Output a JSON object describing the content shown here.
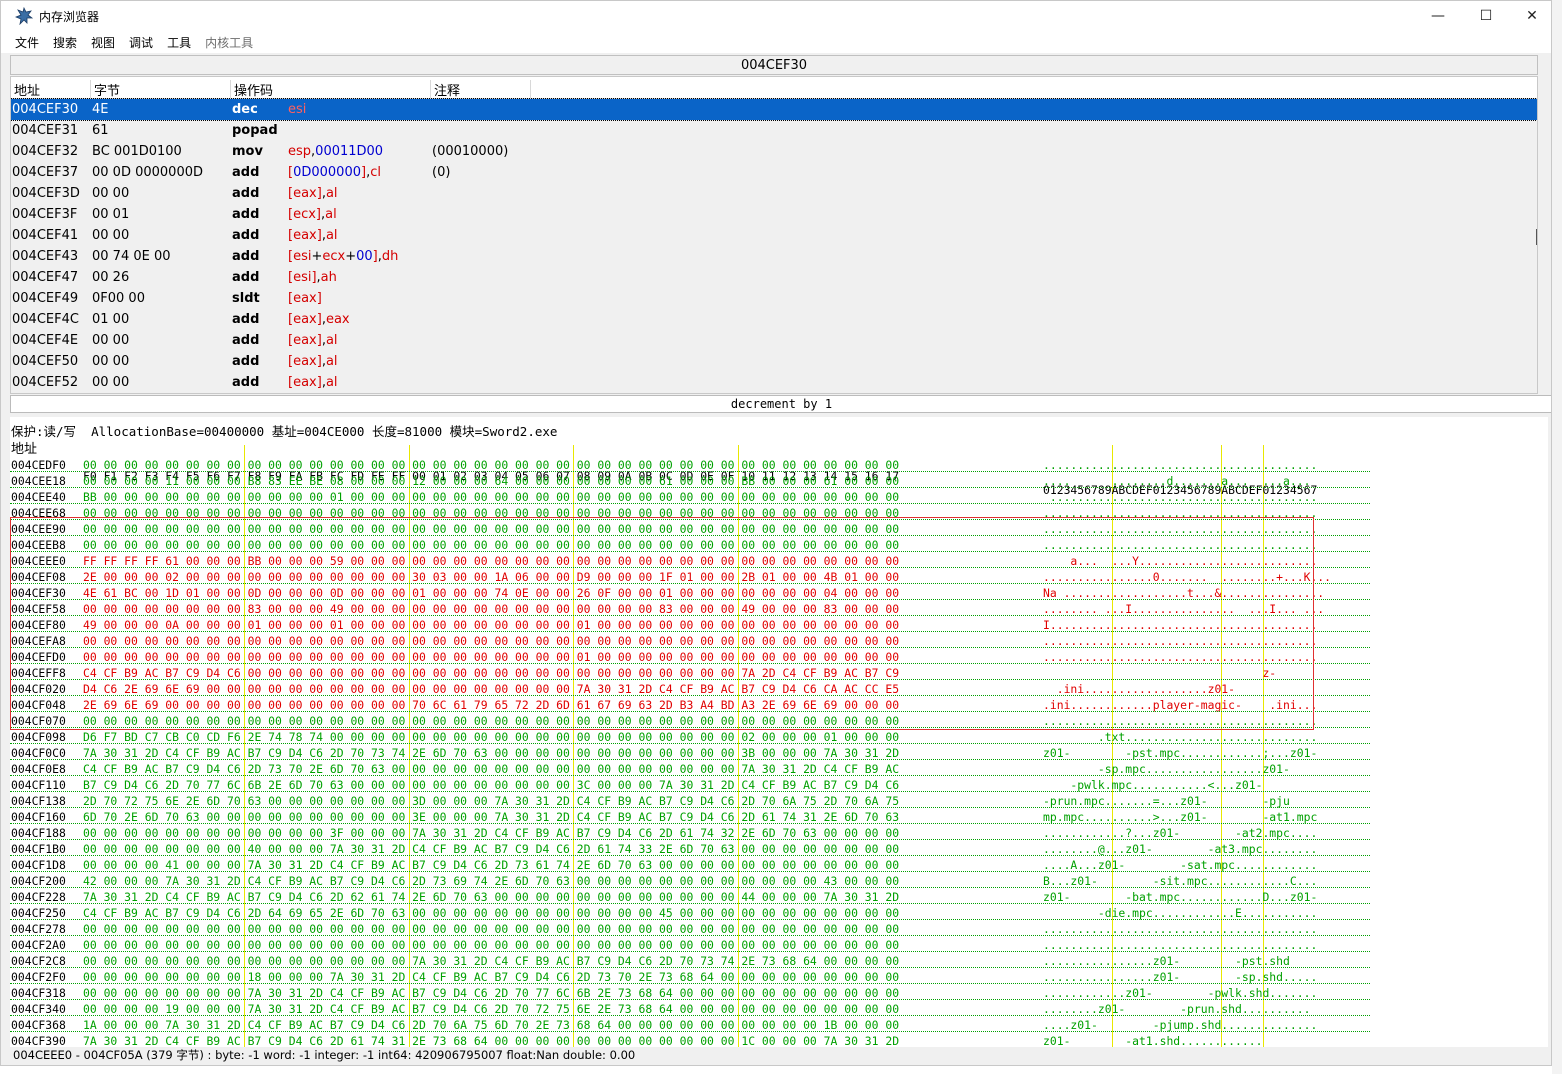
{
  "window": {
    "title": "内存浏览器",
    "minimize": "—",
    "maximize": "☐",
    "close": "✕"
  },
  "menu": [
    "文件",
    "搜索",
    "视图",
    "调试",
    "工具",
    "内核工具"
  ],
  "address_bar": "004CEF30",
  "disasm": {
    "headers": [
      "地址",
      "字节",
      "操作码",
      "注释"
    ],
    "rows": [
      {
        "addr": "004CEF30",
        "bytes": "4E",
        "op": "dec",
        "args": [
          [
            "r",
            "esi"
          ]
        ],
        "cmt": "",
        "selected": true
      },
      {
        "addr": "004CEF31",
        "bytes": "61",
        "op": "popad",
        "args": [],
        "cmt": ""
      },
      {
        "addr": "004CEF32",
        "bytes": "BC 001D0100",
        "op": "mov",
        "args": [
          [
            "r",
            "esp"
          ],
          [
            "p",
            ","
          ],
          [
            "n",
            "00011D00"
          ]
        ],
        "cmt": "(00010000)"
      },
      {
        "addr": "004CEF37",
        "bytes": "00 0D 0000000D",
        "op": "add",
        "args": [
          [
            "r",
            "["
          ],
          [
            "n",
            "0D000000"
          ],
          [
            "r",
            "]"
          ],
          [
            "p",
            ","
          ],
          [
            "r",
            "cl"
          ]
        ],
        "cmt": "(0)"
      },
      {
        "addr": "004CEF3D",
        "bytes": "00 00",
        "op": "add",
        "args": [
          [
            "r",
            "[eax]"
          ],
          [
            "p",
            ","
          ],
          [
            "r",
            "al"
          ]
        ],
        "cmt": ""
      },
      {
        "addr": "004CEF3F",
        "bytes": "00 01",
        "op": "add",
        "args": [
          [
            "r",
            "[ecx]"
          ],
          [
            "p",
            ","
          ],
          [
            "r",
            "al"
          ]
        ],
        "cmt": ""
      },
      {
        "addr": "004CEF41",
        "bytes": "00 00",
        "op": "add",
        "args": [
          [
            "r",
            "[eax]"
          ],
          [
            "p",
            ","
          ],
          [
            "r",
            "al"
          ]
        ],
        "cmt": ""
      },
      {
        "addr": "004CEF43",
        "bytes": "00 74 0E 00",
        "op": "add",
        "args": [
          [
            "r",
            "[esi"
          ],
          [
            "p",
            "+"
          ],
          [
            "r",
            "ecx"
          ],
          [
            "p",
            "+"
          ],
          [
            "n",
            "00"
          ],
          [
            "r",
            "]"
          ],
          [
            "p",
            ","
          ],
          [
            "r",
            "dh"
          ]
        ],
        "cmt": ""
      },
      {
        "addr": "004CEF47",
        "bytes": "00 26",
        "op": "add",
        "args": [
          [
            "r",
            "[esi]"
          ],
          [
            "p",
            ","
          ],
          [
            "r",
            "ah"
          ]
        ],
        "cmt": ""
      },
      {
        "addr": "004CEF49",
        "bytes": "0F00 00",
        "op": "sldt",
        "args": [
          [
            "r",
            "[eax]"
          ]
        ],
        "cmt": ""
      },
      {
        "addr": "004CEF4C",
        "bytes": "01 00",
        "op": "add",
        "args": [
          [
            "r",
            "[eax]"
          ],
          [
            "p",
            ","
          ],
          [
            "r",
            "eax"
          ]
        ],
        "cmt": ""
      },
      {
        "addr": "004CEF4E",
        "bytes": "00 00",
        "op": "add",
        "args": [
          [
            "r",
            "[eax]"
          ],
          [
            "p",
            ","
          ],
          [
            "r",
            "al"
          ]
        ],
        "cmt": ""
      },
      {
        "addr": "004CEF50",
        "bytes": "00 00",
        "op": "add",
        "args": [
          [
            "r",
            "[eax]"
          ],
          [
            "p",
            ","
          ],
          [
            "r",
            "al"
          ]
        ],
        "cmt": ""
      },
      {
        "addr": "004CEF52",
        "bytes": "00 00",
        "op": "add",
        "args": [
          [
            "r",
            "[eax]"
          ],
          [
            "p",
            ","
          ],
          [
            "r",
            "al"
          ]
        ],
        "cmt": ""
      }
    ]
  },
  "description": "decrement by 1",
  "hex": {
    "info": "保护:读/写  AllocationBase=00400000 基址=004CE000 长度=81000 模块=Sword2.exe",
    "header_addr": "地址",
    "header_hex": "F0 F1 F2 F3 F4 F5 F6 F7 F8 F9 FA FB FC FD FE FF 00 01 02 03 04 05 06 07 08 09 0A 0B 0C 0D 0E 0F 10 11 12 13 14 15 16 17",
    "header_text": "0123456789ABCDEF0123456789ABCDEF01234567",
    "rows": [
      {
        "a": "004CEDF0",
        "h": "00 00 00 00 00 00 00 00 00 00 00 00 00 00 00 00 00 00 00 00 00 00 00 00 00 00 00 00 00 00 00 00 00 00 00 00 00 00 00 00",
        "t": "........................................",
        "c": "g"
      },
      {
        "a": "004CEE18",
        "h": "00 00 00 00 11 00 00 00 B8 83 EE BE 08 00 00 00 12 00 00 00 64 00 00 00 00 00 00 00 61 00 00 00 BB 00 00 00 61 00 00 00",
        "t": "....      ........d.......a...  ...a...",
        "c": "g"
      },
      {
        "a": "004CEE40",
        "h": "BB 00 00 00 00 00 00 00 00 00 00 00 01 00 00 00 00 00 00 00 00 00 00 00 00 00 00 00 00 00 00 00 00 00 00 00 00 00 00 00",
        "t": " .......................................",
        "c": "g"
      },
      {
        "a": "004CEE68",
        "h": "00 00 00 00 00 00 00 00 00 00 00 00 00 00 00 00 00 00 00 00 00 00 00 00 00 00 00 00 00 00 00 00 00 00 00 00 00 00 00 00",
        "t": "........................................",
        "c": "g"
      },
      {
        "a": "004CEE90",
        "h": "00 00 00 00 00 00 00 00 00 00 00 00 00 00 00 00 00 00 00 00 00 00 00 00 00 00 00 00 00 00 00 00 00 00 00 00 00 00 00 00",
        "t": "........................................",
        "c": "g"
      },
      {
        "a": "004CEEB8",
        "h": "00 00 00 00 00 00 00 00 00 00 00 00 00 00 00 00 00 00 00 00 00 00 00 00 00 00 00 00 00 00 00 00 00 00 00 00 00 00 00 00",
        "t": "........................................",
        "c": "g"
      },
      {
        "a": "004CEEE0",
        "h": "FF FF FF FF 61 00 00 00 BB 00 00 00 59 00 00 00 00 00 00 00 00 00 00 00 00 00 00 00 00 00 00 00 00 00 00 00 00 00 00 00",
        "t": "    a...  ...Y..........................",
        "c": "r"
      },
      {
        "a": "004CEF08",
        "h": "2E 00 00 00 02 00 00 00 00 00 00 00 00 00 00 00 30 03 00 00 1A 06 00 00 D9 00 00 00 1F 01 00 00 2B 01 00 00 4B 01 00 00",
        "t": "................0.......  ........+...K...",
        "c": "r"
      },
      {
        "a": "004CEF30",
        "h": "4E 61 BC 00 1D 01 00 00 0D 00 00 00 0D 00 00 00 01 00 00 00 74 0E 00 00 26 0F 00 00 01 00 00 00 00 00 00 00 04 00 00 00",
        "t": "Na ..................t...&...............",
        "c": "r"
      },
      {
        "a": "004CEF58",
        "h": "00 00 00 00 00 00 00 00 83 00 00 00 49 00 00 00 00 00 00 00 00 00 00 00 00 00 00 00 83 00 00 00 49 00 00 00 83 00 00 00",
        "t": "........ ...I...............  ...I... ...",
        "c": "r"
      },
      {
        "a": "004CEF80",
        "h": "49 00 00 00 0A 00 00 00 01 00 00 00 01 00 00 00 00 00 00 00 00 00 00 00 01 00 00 00 00 00 00 00 00 00 00 00 00 00 00 00",
        "t": "I.......................................",
        "c": "r"
      },
      {
        "a": "004CEFA8",
        "h": "00 00 00 00 00 00 00 00 00 00 00 00 00 00 00 00 00 00 00 00 00 00 00 00 00 00 00 00 00 00 00 00 00 00 00 00 00 00 00 00",
        "t": "........................................",
        "c": "r"
      },
      {
        "a": "004CEFD0",
        "h": "00 00 00 00 00 00 00 00 00 00 00 00 00 00 00 00 00 00 00 00 00 00 00 00 01 00 00 00 00 00 00 00 00 00 00 00 00 00 00 00",
        "t": "........................................",
        "c": "r"
      },
      {
        "a": "004CEFF8",
        "h": "C4 CF B9 AC B7 C9 D4 C6 00 00 00 00 00 00 00 00 00 00 00 00 00 00 00 00 00 00 00 00 00 00 00 00 7A 2D C4 CF B9 AC B7 C9",
        "t": "                                z-      ",
        "c": "r"
      },
      {
        "a": "004CF020",
        "h": "D4 C6 2E 69 6E 69 00 00 00 00 00 00 00 00 00 00 00 00 00 00 00 00 00 00 7A 30 31 2D C4 CF B9 AC B7 C9 D4 C6 CA AC CC E5",
        "t": "  .ini..................z01-            ",
        "c": "r"
      },
      {
        "a": "004CF048",
        "h": "2E 69 6E 69 00 00 00 00 00 00 00 00 00 00 00 00 70 6C 61 79 65 72 2D 6D 61 67 69 63 2D B3 A4 BD A3 2E 69 6E 69 00 00 00",
        "t": ".ini............player-magic-    .ini...",
        "c": "r"
      },
      {
        "a": "004CF070",
        "h": "00 00 00 00 00 00 00 00 00 00 00 00 00 00 00 00 00 00 00 00 00 00 00 00 00 00 00 00 00 00 00 00 00 00 00 00 00 00 00 00",
        "t": "........................................",
        "c": "g"
      },
      {
        "a": "004CF098",
        "h": "D6 F7 BD C7 CB C0 CD F6 2E 74 78 74 00 00 00 00 00 00 00 00 00 00 00 00 00 00 00 00 00 00 00 00 02 00 00 00 01 00 00 00",
        "t": "        .txt............................",
        "c": "g"
      },
      {
        "a": "004CF0C0",
        "h": "7A 30 31 2D C4 CF B9 AC B7 C9 D4 C6 2D 70 73 74 2E 6D 70 63 00 00 00 00 00 00 00 00 00 00 00 00 3B 00 00 00 7A 30 31 2D",
        "t": "z01-        -pst.mpc............;...z01-",
        "c": "g"
      },
      {
        "a": "004CF0E8",
        "h": "C4 CF B9 AC B7 C9 D4 C6 2D 73 70 2E 6D 70 63 00 00 00 00 00 00 00 00 00 00 00 00 00 00 00 00 00 7A 30 31 2D C4 CF B9 AC",
        "t": "        -sp.mpc.................z01-    ",
        "c": "g"
      },
      {
        "a": "004CF110",
        "h": "B7 C9 D4 C6 2D 70 77 6C 6B 2E 6D 70 63 00 00 00 00 00 00 00 00 00 00 00 3C 00 00 00 7A 30 31 2D C4 CF B9 AC B7 C9 D4 C6",
        "t": "    -pwlk.mpc...........<...z01-        ",
        "c": "g"
      },
      {
        "a": "004CF138",
        "h": "2D 70 72 75 6E 2E 6D 70 63 00 00 00 00 00 00 00 3D 00 00 00 7A 30 31 2D C4 CF B9 AC B7 C9 D4 C6 2D 70 6A 75 2D 70 6A 75",
        "t": "-prun.mpc.......=...z01-        -pju",
        "c": "g"
      },
      {
        "a": "004CF160",
        "h": "6D 70 2E 6D 70 63 00 00 00 00 00 00 00 00 00 00 3E 00 00 00 7A 30 31 2D C4 CF B9 AC B7 C9 D4 C6 2D 61 74 31 2E 6D 70 63",
        "t": "mp.mpc..........>...z01-        -at1.mpc",
        "c": "g"
      },
      {
        "a": "004CF188",
        "h": "00 00 00 00 00 00 00 00 00 00 00 00 3F 00 00 00 7A 30 31 2D C4 CF B9 AC B7 C9 D4 C6 2D 61 74 32 2E 6D 70 63 00 00 00 00",
        "t": "............?...z01-        -at2.mpc....",
        "c": "g"
      },
      {
        "a": "004CF1B0",
        "h": "00 00 00 00 00 00 00 00 40 00 00 00 7A 30 31 2D C4 CF B9 AC B7 C9 D4 C6 2D 61 74 33 2E 6D 70 63 00 00 00 00 00 00 00 00",
        "t": "........@...z01-        -at3.mpc........",
        "c": "g"
      },
      {
        "a": "004CF1D8",
        "h": "00 00 00 00 41 00 00 00 7A 30 31 2D C4 CF B9 AC B7 C9 D4 C6 2D 73 61 74 2E 6D 70 63 00 00 00 00 00 00 00 00 00 00 00 00",
        "t": "....A...z01-        -sat.mpc............",
        "c": "g"
      },
      {
        "a": "004CF200",
        "h": "42 00 00 00 7A 30 31 2D C4 CF B9 AC B7 C9 D4 C6 2D 73 69 74 2E 6D 70 63 00 00 00 00 00 00 00 00 00 00 00 00 43 00 00 00",
        "t": "B...z01-        -sit.mpc............C...",
        "c": "g"
      },
      {
        "a": "004CF228",
        "h": "7A 30 31 2D C4 CF B9 AC B7 C9 D4 C6 2D 62 61 74 2E 6D 70 63 00 00 00 00 00 00 00 00 00 00 00 00 44 00 00 00 7A 30 31 2D",
        "t": "z01-        -bat.mpc............D...z01-",
        "c": "g"
      },
      {
        "a": "004CF250",
        "h": "C4 CF B9 AC B7 C9 D4 C6 2D 64 69 65 2E 6D 70 63 00 00 00 00 00 00 00 00 00 00 00 00 45 00 00 00 00 00 00 00 00 00 00 00",
        "t": "        -die.mpc............E...........",
        "c": "g"
      },
      {
        "a": "004CF278",
        "h": "00 00 00 00 00 00 00 00 00 00 00 00 00 00 00 00 00 00 00 00 00 00 00 00 00 00 00 00 00 00 00 00 00 00 00 00 00 00 00 00",
        "t": "........................................",
        "c": "g"
      },
      {
        "a": "004CF2A0",
        "h": "00 00 00 00 00 00 00 00 00 00 00 00 00 00 00 00 00 00 00 00 00 00 00 00 00 00 00 00 00 00 00 00 00 00 00 00 00 00 00 00",
        "t": "........................................",
        "c": "g"
      },
      {
        "a": "004CF2C8",
        "h": "00 00 00 00 00 00 00 00 00 00 00 00 00 00 00 00 7A 30 31 2D C4 CF B9 AC B7 C9 D4 C6 2D 70 73 74 2E 73 68 64 00 00 00 00",
        "t": "................z01-        -pst.shd",
        "c": "g"
      },
      {
        "a": "004CF2F0",
        "h": "00 00 00 00 00 00 00 00 18 00 00 00 7A 30 31 2D C4 CF B9 AC B7 C9 D4 C6 2D 73 70 2E 73 68 64 00 00 00 00 00 00 00 00 00",
        "t": "................z01-        -sp.shd.....",
        "c": "g"
      },
      {
        "a": "004CF318",
        "h": "00 00 00 00 00 00 00 00 7A 30 31 2D C4 CF B9 AC B7 C9 D4 C6 2D 70 77 6C 6B 2E 73 68 64 00 00 00 00 00 00 00 00 00 00 00",
        "t": "............z01-        -pwlk.shd.......",
        "c": "g"
      },
      {
        "a": "004CF340",
        "h": "00 00 00 00 19 00 00 00 7A 30 31 2D C4 CF B9 AC B7 C9 D4 C6 2D 70 72 75 6E 2E 73 68 64 00 00 00 00 00 00 00 00 00 00 00",
        "t": "........z01-        -prun.shd..........",
        "c": "g"
      },
      {
        "a": "004CF368",
        "h": "1A 00 00 00 7A 30 31 2D C4 CF B9 AC B7 C9 D4 C6 2D 70 6A 75 6D 70 2E 73 68 64 00 00 00 00 00 00 00 00 00 00 1B 00 00 00",
        "t": "....z01-        -pjump.shd..............",
        "c": "g"
      },
      {
        "a": "004CF390",
        "h": "7A 30 31 2D C4 CF B9 AC B7 C9 D4 C6 2D 61 74 31 2E 73 68 64 00 00 00 00 00 00 00 00 00 00 00 00 1C 00 00 00 7A 30 31 2D",
        "t": "z01-        -at1.shd............",
        "c": "g"
      }
    ]
  },
  "status": "004CEEE0 - 004CF05A (379 字节) : byte: -1 word: -1 integer: -1 int64: 420906795007 float:Nan double: 0.00",
  "colors": {
    "selection": "#0a64c8",
    "register": "#d40000",
    "number": "#0000d0",
    "hex_default": "#00a000",
    "hex_selected": "#e00000",
    "column_guides": "#e8e800"
  }
}
